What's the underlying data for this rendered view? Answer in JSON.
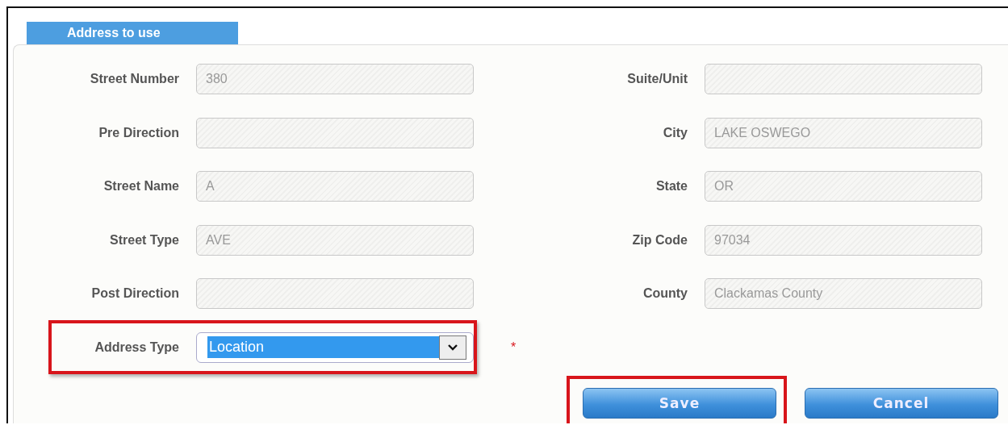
{
  "section": {
    "title": "Address to use"
  },
  "left_fields": [
    {
      "label": "Street Number",
      "kind": "text",
      "value": "380",
      "highlighted": false
    },
    {
      "label": "Pre Direction",
      "kind": "text",
      "highlighted": false
    },
    {
      "label": "Street Name",
      "kind": "text",
      "value": "A",
      "highlighted": false
    },
    {
      "label": "Street Type",
      "kind": "text",
      "value": "AVE",
      "highlighted": false
    },
    {
      "label": "Post Direction",
      "kind": "text",
      "highlighted": false
    },
    {
      "label": "Address Type",
      "kind": "select",
      "value": "Location",
      "highlighted": true,
      "required_mark": "*"
    }
  ],
  "right_fields": [
    {
      "label": "Suite/Unit",
      "kind": "text"
    },
    {
      "label": "City",
      "kind": "text",
      "value": "LAKE OSWEGO"
    },
    {
      "label": "State",
      "kind": "text",
      "value": "OR"
    },
    {
      "label": "Zip Code",
      "kind": "text",
      "value": "97034"
    },
    {
      "label": "County",
      "kind": "text",
      "value": "Clackamas County"
    }
  ],
  "buttons": [
    {
      "label": "Save",
      "highlighted": true
    },
    {
      "label": "Cancel",
      "highlighted": false
    }
  ]
}
